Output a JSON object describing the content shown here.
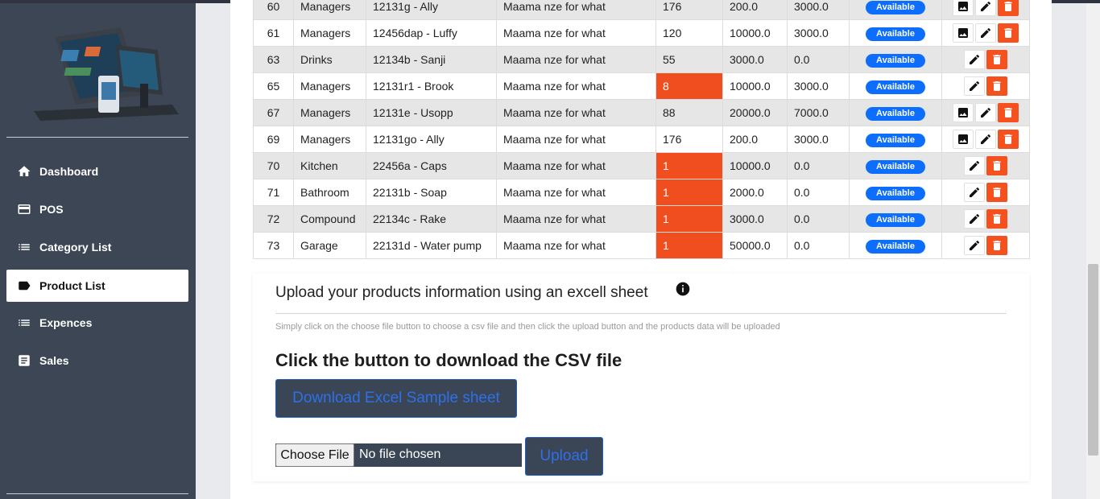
{
  "sidebar": {
    "items": [
      {
        "label": "Dashboard",
        "icon": "home-icon",
        "active": false
      },
      {
        "label": "POS",
        "icon": "card-icon",
        "active": false
      },
      {
        "label": "Category List",
        "icon": "list-icon",
        "active": false
      },
      {
        "label": "Product List",
        "icon": "tag-icon",
        "active": true
      },
      {
        "label": "Expences",
        "icon": "list-icon",
        "active": false
      },
      {
        "label": "Sales",
        "icon": "document-icon",
        "active": false
      }
    ]
  },
  "table": {
    "status_label": "Available",
    "rows": [
      {
        "id": "60",
        "category": "Managers",
        "name": "12131g - Ally",
        "description": "Maama nze for what",
        "qty": "176",
        "price": "200.0",
        "cost": "3000.0",
        "has_image": true,
        "low": false
      },
      {
        "id": "61",
        "category": "Managers",
        "name": "12456dap - Luffy",
        "description": "Maama nze for what",
        "qty": "120",
        "price": "10000.0",
        "cost": "3000.0",
        "has_image": true,
        "low": false
      },
      {
        "id": "63",
        "category": "Drinks",
        "name": "12134b - Sanji",
        "description": "Maama nze for what",
        "qty": "55",
        "price": "3000.0",
        "cost": "0.0",
        "has_image": false,
        "low": false
      },
      {
        "id": "65",
        "category": "Managers",
        "name": "12131r1 - Brook",
        "description": "Maama nze for what",
        "qty": "8",
        "price": "10000.0",
        "cost": "3000.0",
        "has_image": false,
        "low": true
      },
      {
        "id": "67",
        "category": "Managers",
        "name": "12131e - Usopp",
        "description": "Maama nze for what",
        "qty": "88",
        "price": "20000.0",
        "cost": "7000.0",
        "has_image": true,
        "low": false
      },
      {
        "id": "69",
        "category": "Managers",
        "name": "12131go - Ally",
        "description": "Maama nze for what",
        "qty": "176",
        "price": "200.0",
        "cost": "3000.0",
        "has_image": true,
        "low": false
      },
      {
        "id": "70",
        "category": "Kitchen",
        "name": "22456a - Caps",
        "description": "Maama nze for what",
        "qty": "1",
        "price": "10000.0",
        "cost": "0.0",
        "has_image": false,
        "low": true
      },
      {
        "id": "71",
        "category": "Bathroom",
        "name": "22131b - Soap",
        "description": "Maama nze for what",
        "qty": "1",
        "price": "2000.0",
        "cost": "0.0",
        "has_image": false,
        "low": true
      },
      {
        "id": "72",
        "category": "Compound",
        "name": "22134c - Rake",
        "description": "Maama nze for what",
        "qty": "1",
        "price": "3000.0",
        "cost": "0.0",
        "has_image": false,
        "low": true
      },
      {
        "id": "73",
        "category": "Garage",
        "name": "22131d - Water pump",
        "description": "Maama nze for what",
        "qty": "1",
        "price": "50000.0",
        "cost": "0.0",
        "has_image": false,
        "low": true
      }
    ]
  },
  "upload": {
    "title": "Upload your products information using an excell sheet",
    "hint": "Simply click on the choose file button to choose a csv file and then click the upload button and the products data will be uploaded",
    "heading": "Click the button to download the CSV file",
    "download_label": "Download Excel Sample sheet",
    "choose_file_label": "Choose File",
    "file_status": "No file chosen",
    "upload_label": "Upload"
  },
  "colors": {
    "sidebar": "#3d4654",
    "low_stock": "#f04e1f",
    "badge": "#0d6efd",
    "delete": "#f4511e"
  }
}
